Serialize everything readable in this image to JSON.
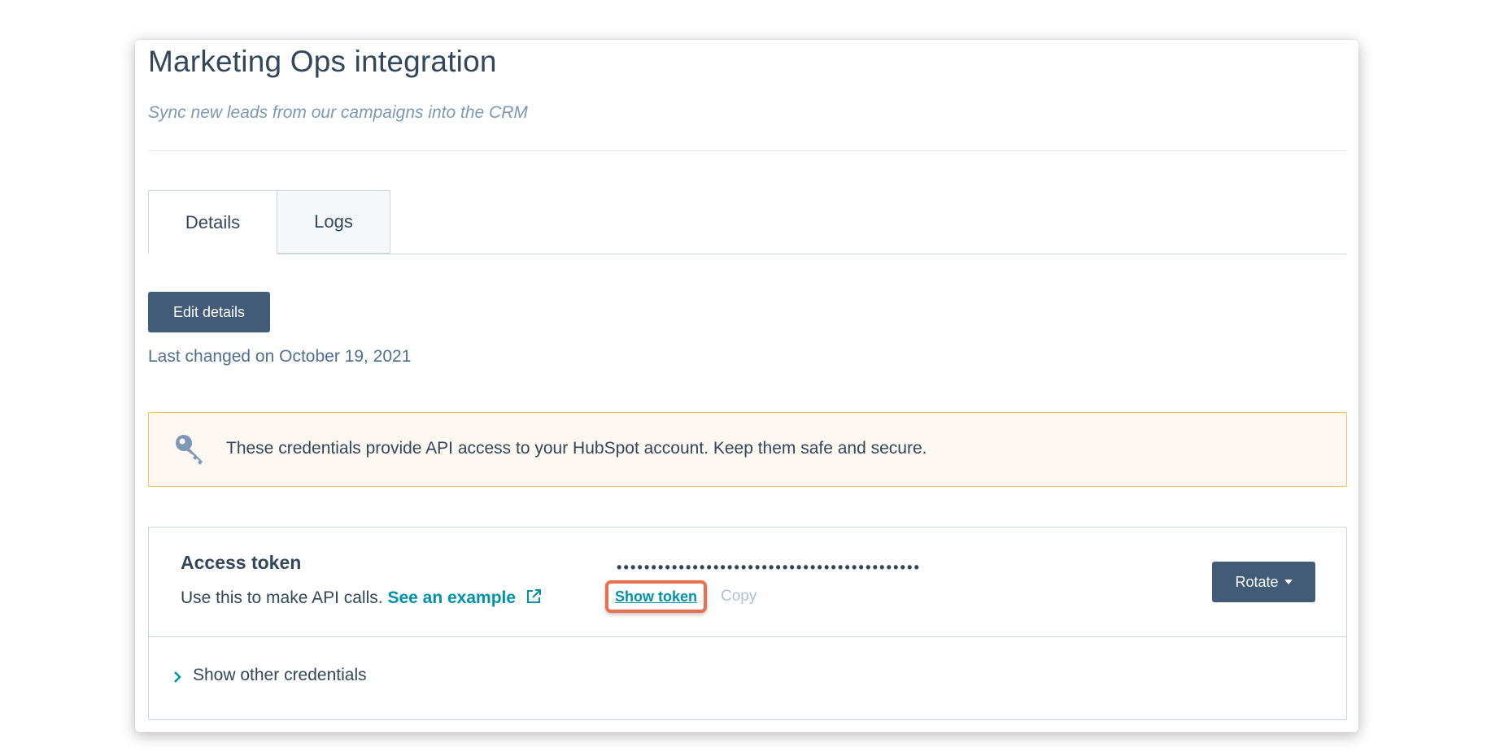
{
  "header": {
    "title": "Marketing Ops integration",
    "subtitle": "Sync new leads from our campaigns into the CRM"
  },
  "tabs": [
    {
      "label": "Details",
      "active": true
    },
    {
      "label": "Logs",
      "active": false
    }
  ],
  "details": {
    "edit_button": "Edit details",
    "last_changed": "Last changed on October 19, 2021"
  },
  "alert": {
    "icon": "key-icon",
    "text": "These credentials provide API access to your HubSpot account. Keep them safe and secure."
  },
  "credentials": {
    "label": "Access token",
    "description": "Use this to make API calls.",
    "example_link": "See an example",
    "masked_token": "••••••••••••••••••••••••••••••••••••••••••••",
    "show_token": "Show token",
    "copy": "Copy",
    "rotate_button": "Rotate",
    "other_credentials": "Show other credentials"
  },
  "colors": {
    "primary_button": "#425b76",
    "link": "#0091ae",
    "highlight": "#e8704f",
    "alert_bg": "#fdf8f1",
    "alert_border": "#f5c26b"
  }
}
